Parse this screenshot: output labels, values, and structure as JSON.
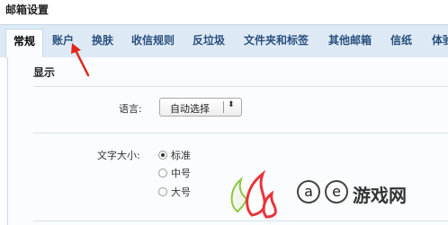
{
  "page_title": "邮箱设置",
  "tabs": [
    {
      "label": "常规",
      "active": true
    },
    {
      "label": "账户"
    },
    {
      "label": "换肤"
    },
    {
      "label": "收信规则"
    },
    {
      "label": "反垃圾"
    },
    {
      "label": "文件夹和标签"
    },
    {
      "label": "其他邮箱"
    },
    {
      "label": "信纸"
    },
    {
      "label": "体验"
    }
  ],
  "section": {
    "title": "显示"
  },
  "language": {
    "label": "语言:",
    "selected": "自动选择"
  },
  "font_size": {
    "label": "文字大小:",
    "options": [
      {
        "label": "标准",
        "checked": true
      },
      {
        "label": "中号",
        "checked": false
      },
      {
        "label": "大号",
        "checked": false
      }
    ]
  },
  "watermark": {
    "letters": [
      "a",
      "e"
    ],
    "text": "游戏网"
  },
  "colors": {
    "tab_bar": "#ddeaf6",
    "tab_text": "#2a4f7d",
    "arrow": "#e0271b"
  }
}
